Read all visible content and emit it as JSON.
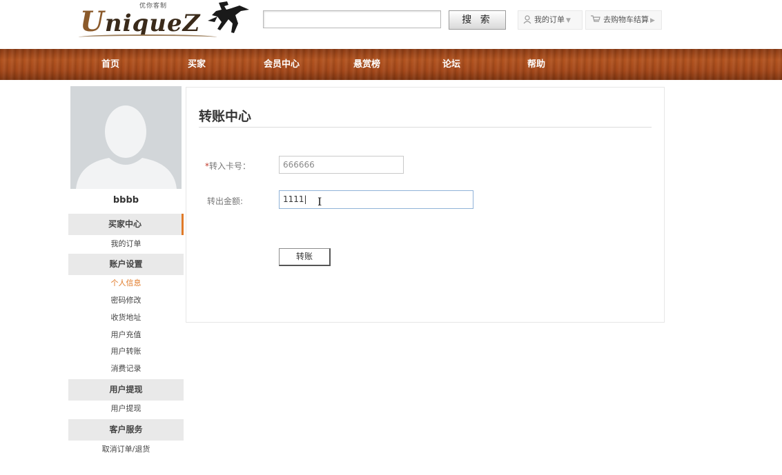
{
  "header": {
    "logo_subtitle": "优你客制",
    "logo_text": "niqueZ",
    "logo_initial": "U",
    "search_placeholder": "",
    "search_button": "搜 索",
    "my_orders": "我的订单",
    "cart_checkout": "去购物车结算"
  },
  "nav": {
    "items": [
      "首页",
      "买家",
      "会员中心",
      "悬赏榜",
      "论坛",
      "帮助"
    ]
  },
  "sidebar": {
    "username": "bbbb",
    "sections": [
      {
        "title": "买家中心",
        "items": [
          "我的订单"
        ]
      },
      {
        "title": "账户设置",
        "items": [
          "个人信息",
          "密码修改",
          "收货地址",
          "用户充值",
          "用户转账",
          "消费记录"
        ]
      },
      {
        "title": "用户提现",
        "items": [
          "用户提现"
        ]
      },
      {
        "title": "客户服务",
        "items": [
          "取消订单/退货"
        ]
      }
    ],
    "current_item": "个人信息"
  },
  "main": {
    "title": "转账中心",
    "card_label_required": "*",
    "card_label": "转入卡号：",
    "card_value": "666666",
    "amount_label": "转出金额:",
    "amount_value": "1111",
    "submit": "转账"
  },
  "colors": {
    "accent": "#e07a28",
    "nav_wood": "#a34719"
  },
  "icons": {
    "user": "user-icon",
    "cart": "cart-icon",
    "caret": "caret-down-icon",
    "arrow": "arrow-right-icon"
  }
}
